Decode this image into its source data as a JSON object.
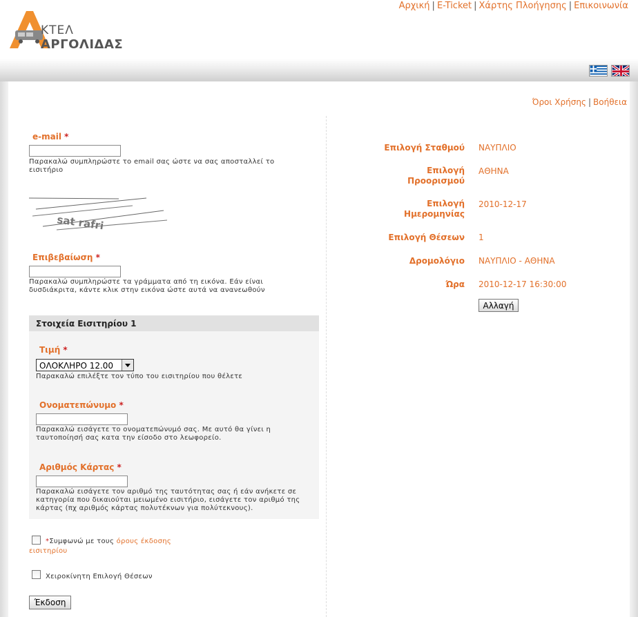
{
  "colors": {
    "accent": "#e2702a",
    "required": "#cc2222"
  },
  "header": {
    "logo_line1": "ΚΤΕΛ",
    "logo_line2": "ΑΡΓΟΛΙΔΑΣ",
    "nav": [
      "Αρχική",
      "E-Ticket",
      "Χάρτης Πλοήγησης",
      "Επικοινωνία"
    ],
    "nav_sep": "|"
  },
  "sub_nav": [
    "Όροι Χρήσης",
    "Βοήθεια"
  ],
  "form": {
    "email_label": "e-mail",
    "required_mark": "*",
    "email_value": "",
    "email_help": "Παρακαλώ συμπληρώστε το email σας ώστε να σας αποσταλλεί το εισιτήριο",
    "captcha_text": "sat rafri",
    "confirm_label": "Επιβεβαίωση",
    "confirm_value": "",
    "confirm_help": "Παρακαλώ συμπληρώστε τα γράμματα από τη εικόνα. Εάν είναι δυσδιάκριτα, κάντε κλικ στην εικόνα ώστε αυτά να ανανεωθούν",
    "ticket_section_title": "Στοιχεία Εισιτηρίου 1",
    "price_label": "Τιμή",
    "price_selected": "ΟΛΟΚΛΗΡΟ 12.00",
    "price_help": "Παρακαλώ επιλέξτε τον τύπο του εισιτηρίου που θέλετε",
    "name_label": "Ονοματεπώνυμο",
    "name_value": "",
    "name_help": "Παρακαλώ εισάγετε το ονοματεπώνυμό σας. Με αυτό θα γίνει η ταυτοποίησή σας κατα την είσοδο στο λεωφορείο.",
    "card_label": "Αριθμός Κάρτας",
    "card_value": "",
    "card_help": "Παρακαλώ εισάγετε τον αριθμό της ταυτότητας σας ή εάν ανήκετε σε κατηγορία που δικαιούται μειωμένο εισιτήριο, εισάγετε τον αριθμό της κάρτας (πχ αριθμός κάρτας πολυτέκνων για πολύτεκνους).",
    "terms_prefix": "Συμφωνώ με τους",
    "terms_link": "όρους έκδοσης εισιτηρίου",
    "terms_link_part1": "όρους έκδοσης",
    "terms_link_part2": "εισιτηρίου",
    "manual_seats_label": "Χειροκίνητη Επιλογή Θέσεων",
    "submit_label": "Έκδοση"
  },
  "summary": {
    "station_label": "Επιλογή Σταθμού",
    "station_value": "ΝΑΥΠΛΙΟ",
    "dest_label_1": "Επιλογή",
    "dest_label_2": "Προορισμού",
    "dest_value": "ΑΘΗΝΑ",
    "date_label_1": "Επιλογή",
    "date_label_2": "Ημερομηνίας",
    "date_value": "2010-12-17",
    "seats_label": "Επιλογή Θέσεων",
    "seats_value": "1",
    "route_label": "Δρομολόγιο",
    "route_value": "ΝΑΥΠΛΙΟ - ΑΘΗΝΑ",
    "time_label": "Ώρα",
    "time_value": "2010-12-17 16:30:00",
    "change_button": "Αλλαγή"
  }
}
